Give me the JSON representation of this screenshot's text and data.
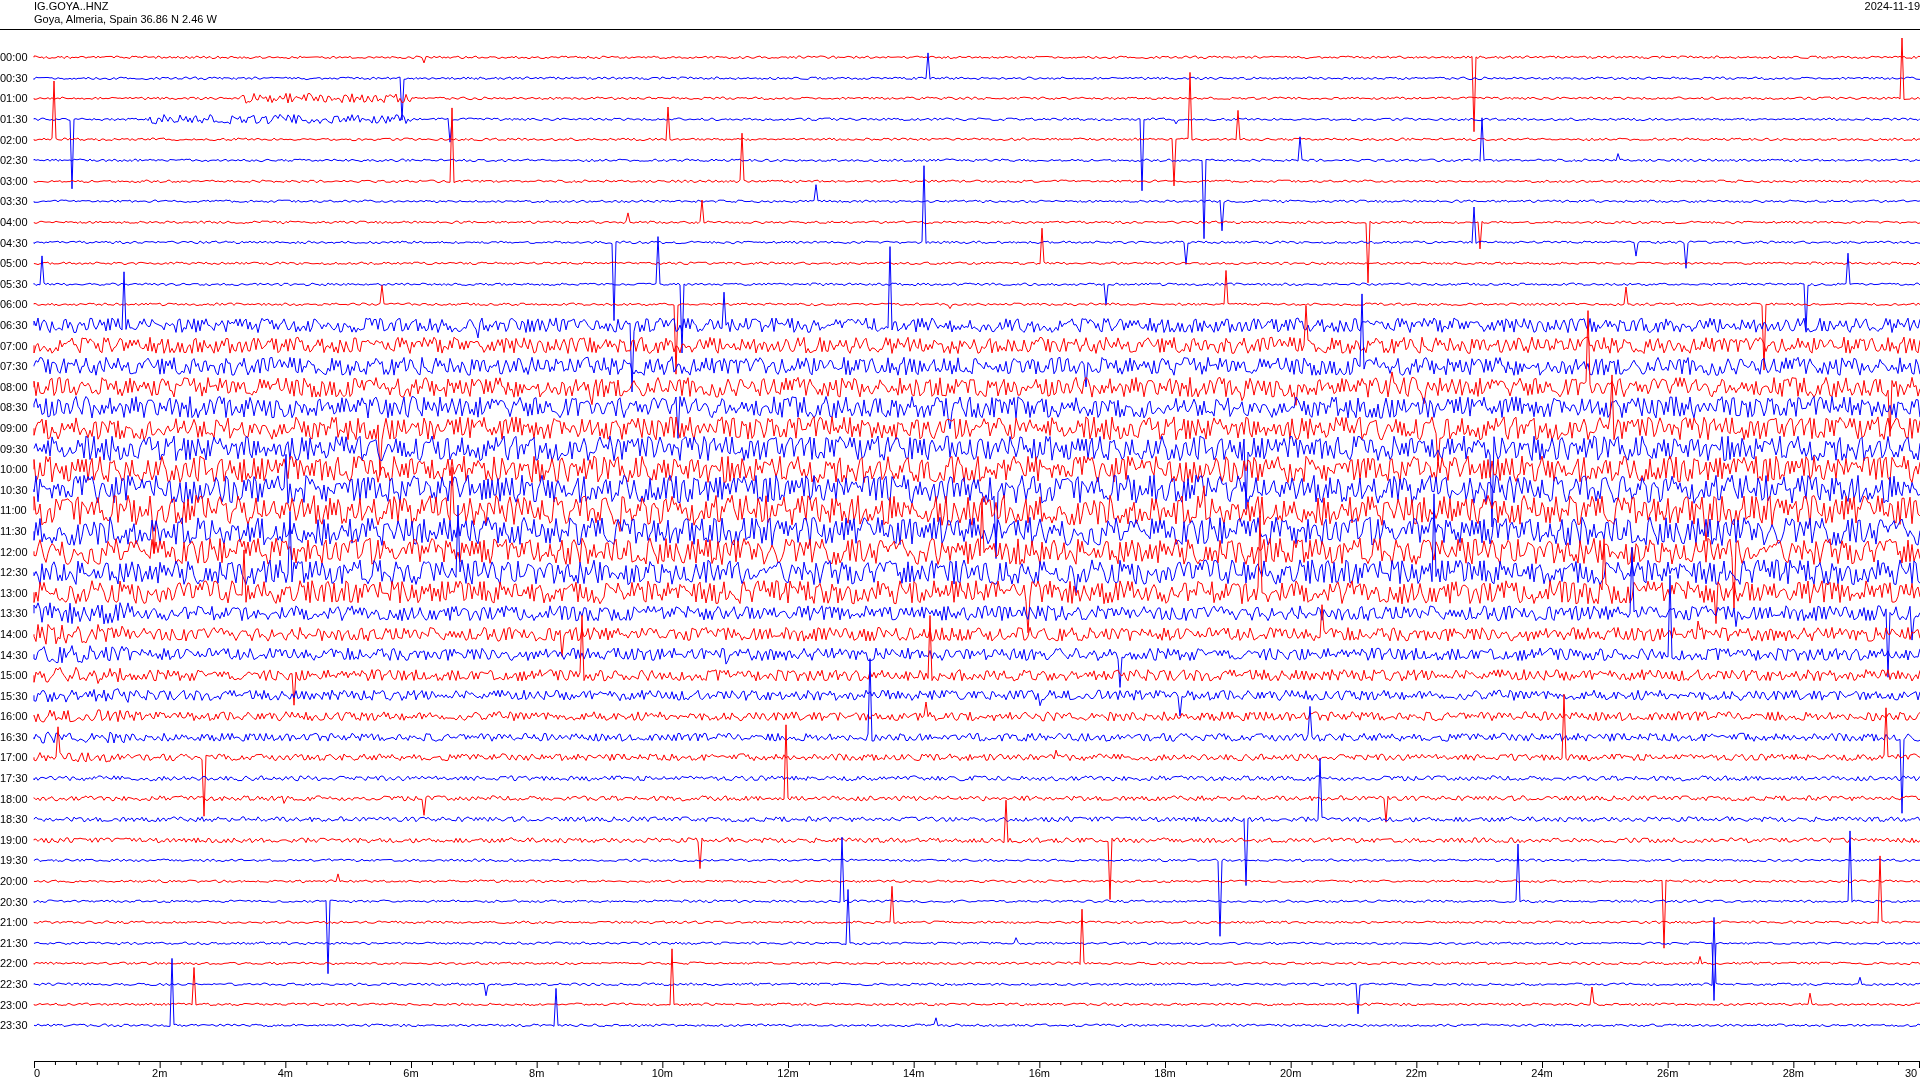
{
  "header": {
    "station": "IG.GOYA..HNZ",
    "location": "Goya, Almeria, Spain  36.86 N 2.46 W",
    "date": "2024-11-19"
  },
  "rows": [
    {
      "time": "00:00",
      "color": "#ff0000"
    },
    {
      "time": "00:30",
      "color": "#0000ff"
    },
    {
      "time": "01:00",
      "color": "#ff0000"
    },
    {
      "time": "01:30",
      "color": "#0000ff"
    },
    {
      "time": "02:00",
      "color": "#ff0000"
    },
    {
      "time": "02:30",
      "color": "#0000ff"
    },
    {
      "time": "03:00",
      "color": "#ff0000"
    },
    {
      "time": "03:30",
      "color": "#0000ff"
    },
    {
      "time": "04:00",
      "color": "#ff0000"
    },
    {
      "time": "04:30",
      "color": "#0000ff"
    },
    {
      "time": "05:00",
      "color": "#ff0000"
    },
    {
      "time": "05:30",
      "color": "#0000ff"
    },
    {
      "time": "06:00",
      "color": "#ff0000"
    },
    {
      "time": "06:30",
      "color": "#0000ff"
    },
    {
      "time": "07:00",
      "color": "#ff0000"
    },
    {
      "time": "07:30",
      "color": "#0000ff"
    },
    {
      "time": "08:00",
      "color": "#ff0000"
    },
    {
      "time": "08:30",
      "color": "#0000ff"
    },
    {
      "time": "09:00",
      "color": "#ff0000"
    },
    {
      "time": "09:30",
      "color": "#0000ff"
    },
    {
      "time": "10:00",
      "color": "#ff0000"
    },
    {
      "time": "10:30",
      "color": "#0000ff"
    },
    {
      "time": "11:00",
      "color": "#ff0000"
    },
    {
      "time": "11:30",
      "color": "#0000ff"
    },
    {
      "time": "12:00",
      "color": "#ff0000"
    },
    {
      "time": "12:30",
      "color": "#0000ff"
    },
    {
      "time": "13:00",
      "color": "#ff0000"
    },
    {
      "time": "13:30",
      "color": "#0000ff"
    },
    {
      "time": "14:00",
      "color": "#ff0000"
    },
    {
      "time": "14:30",
      "color": "#0000ff"
    },
    {
      "time": "15:00",
      "color": "#ff0000"
    },
    {
      "time": "15:30",
      "color": "#0000ff"
    },
    {
      "time": "16:00",
      "color": "#ff0000"
    },
    {
      "time": "16:30",
      "color": "#0000ff"
    },
    {
      "time": "17:00",
      "color": "#ff0000"
    },
    {
      "time": "17:30",
      "color": "#0000ff"
    },
    {
      "time": "18:00",
      "color": "#ff0000"
    },
    {
      "time": "18:30",
      "color": "#0000ff"
    },
    {
      "time": "19:00",
      "color": "#ff0000"
    },
    {
      "time": "19:30",
      "color": "#0000ff"
    },
    {
      "time": "20:00",
      "color": "#ff0000"
    },
    {
      "time": "20:30",
      "color": "#0000ff"
    },
    {
      "time": "21:00",
      "color": "#ff0000"
    },
    {
      "time": "21:30",
      "color": "#0000ff"
    },
    {
      "time": "22:00",
      "color": "#ff0000"
    },
    {
      "time": "22:30",
      "color": "#0000ff"
    },
    {
      "time": "23:00",
      "color": "#ff0000"
    },
    {
      "time": "23:30",
      "color": "#0000ff"
    }
  ],
  "x_axis": {
    "labels": [
      "0",
      "2m",
      "4m",
      "6m",
      "8m",
      "10m",
      "12m",
      "14m",
      "16m",
      "18m",
      "20m",
      "22m",
      "24m",
      "26m",
      "28m",
      "30"
    ]
  }
}
